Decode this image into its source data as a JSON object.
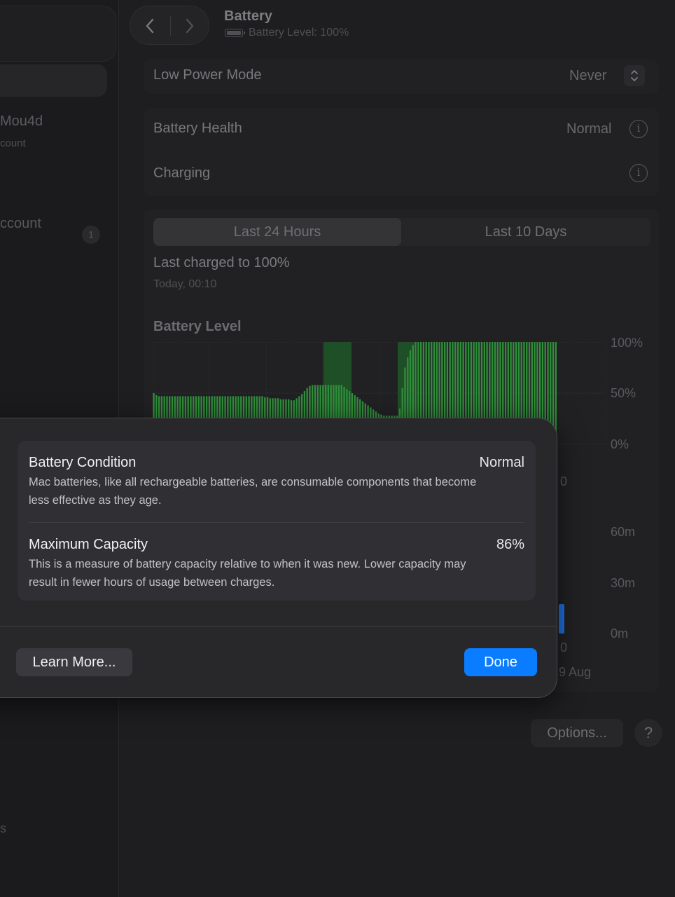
{
  "sidebar": {
    "user_name": "Mou4d",
    "user_sub": "count",
    "account_label": "ccount",
    "account_badge": "1",
    "bottom_text": "s"
  },
  "header": {
    "title": "Battery",
    "subtitle": "Battery Level: 100%"
  },
  "low_power": {
    "label": "Low Power Mode",
    "value": "Never"
  },
  "health": {
    "label": "Battery Health",
    "value": "Normal",
    "charging_label": "Charging"
  },
  "history": {
    "tabs": [
      "Last 24 Hours",
      "Last 10 Days"
    ],
    "selected_tab": "Last 24 Hours",
    "last_charged": "Last charged to 100%",
    "last_charged_time": "Today, 00:10",
    "chart_title": "Battery Level",
    "level_ticks": [
      "100%",
      "50%",
      "0%"
    ],
    "usage_ticks": [
      "60m",
      "30m",
      "0m"
    ],
    "peek_labels": [
      "0",
      "0",
      "9 Aug"
    ]
  },
  "chart_data": {
    "type": "bar",
    "title": "Battery Level",
    "ylim": [
      0,
      100
    ],
    "ytick_labels": [
      "100%",
      "50%",
      "0%"
    ],
    "series": [
      {
        "values": [
          50,
          48,
          47,
          47,
          47,
          47,
          47,
          47,
          47,
          47,
          47,
          47,
          47,
          47,
          47,
          47,
          47,
          47,
          47,
          47,
          47,
          47,
          47,
          47,
          47,
          47,
          47,
          47,
          47,
          47,
          47,
          47,
          47,
          47,
          47,
          47,
          47,
          47,
          47,
          47,
          47,
          47,
          46,
          46,
          45,
          45,
          45,
          45,
          44,
          44,
          44,
          44,
          43,
          43,
          45,
          47,
          49,
          52,
          55,
          57,
          58,
          58,
          58,
          58,
          58,
          58,
          58,
          58,
          58,
          58,
          58,
          58,
          56,
          54,
          52,
          50,
          48,
          46,
          44,
          42,
          40,
          38,
          36,
          34,
          32,
          30,
          29,
          28,
          28,
          28,
          28,
          28,
          28,
          35,
          55,
          75,
          85,
          92,
          97,
          100,
          100,
          100,
          100,
          100,
          100,
          100,
          100,
          100,
          100,
          100,
          100,
          100,
          100,
          100,
          100,
          100,
          100,
          100,
          100,
          100,
          100,
          100,
          100,
          100,
          100,
          100,
          100,
          100,
          100,
          100,
          100,
          100,
          100,
          100,
          100,
          100,
          100,
          100,
          100,
          100,
          100,
          100,
          100,
          100,
          100,
          100,
          100,
          100,
          100,
          100,
          100,
          100,
          100
        ]
      }
    ],
    "grid": true
  },
  "footer": {
    "options_label": "Options...",
    "help_label": "?"
  },
  "sheet": {
    "condition_title": "Battery Condition",
    "condition_value": "Normal",
    "condition_desc": "Mac batteries, like all rechargeable batteries, are consumable components that become less effective as they age.",
    "capacity_title": "Maximum Capacity",
    "capacity_value": "86%",
    "capacity_desc": "This is a measure of battery capacity relative to when it was new. Lower capacity may result in fewer hours of usage between charges.",
    "learn_more_label": "Learn More...",
    "done_label": "Done"
  },
  "colors": {
    "accent": "#0a7cff",
    "chart_green": "#2f8f3a",
    "chart_highlight": "#1f5f2a",
    "usage_blue": "#1f6fe0"
  }
}
